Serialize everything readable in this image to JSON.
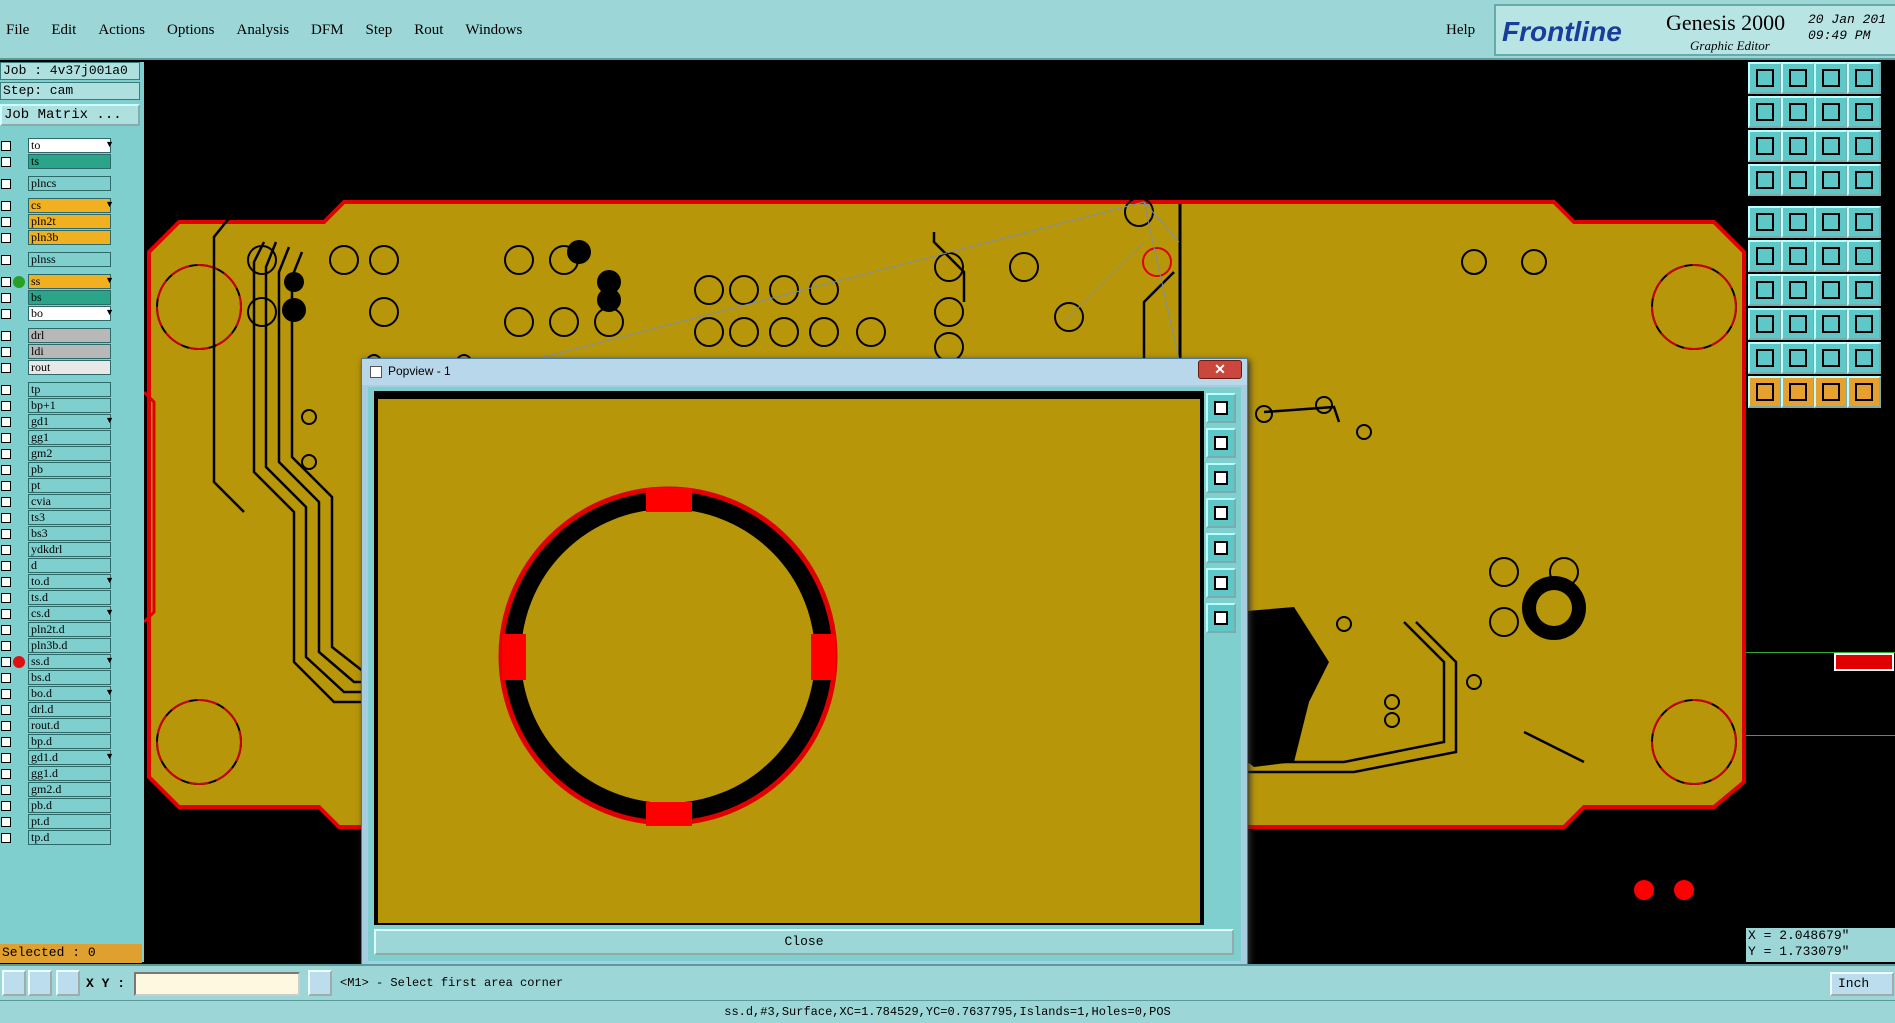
{
  "menu": {
    "items": [
      "File",
      "Edit",
      "Actions",
      "Options",
      "Analysis",
      "DFM",
      "Step",
      "Rout",
      "Windows"
    ],
    "help": "Help"
  },
  "brand": {
    "logo": "Frontline",
    "product": "Genesis 2000",
    "subtitle": "Graphic Editor",
    "date": "20 Jan 201",
    "time": "09:49 PM"
  },
  "left": {
    "job": "Job : 4v37j001a0",
    "step": "Step: cam",
    "matrix_button": "Job Matrix ...",
    "selected": "Selected : 0"
  },
  "layers": [
    {
      "name": "to",
      "bg": "#ffffff",
      "arrow": true
    },
    {
      "name": "ts",
      "bg": "#2aa58a",
      "arrow": false
    },
    {
      "name": "plncs",
      "bg": "#7fcfcf",
      "arrow": false
    },
    {
      "name": "cs",
      "bg": "#f0b020",
      "arrow": true
    },
    {
      "name": "pln2t",
      "bg": "#f0b020",
      "arrow": false
    },
    {
      "name": "pln3b",
      "bg": "#f0b020",
      "arrow": false
    },
    {
      "name": "plnss",
      "bg": "#7fcfcf",
      "arrow": false
    },
    {
      "name": "ss",
      "bg": "#f0b020",
      "arrow": true,
      "dot": "#28a028"
    },
    {
      "name": "bs",
      "bg": "#2aa58a",
      "arrow": false
    },
    {
      "name": "bo",
      "bg": "#ffffff",
      "arrow": true
    },
    {
      "name": "drl",
      "bg": "#b8b8b8",
      "arrow": false
    },
    {
      "name": "ldi",
      "bg": "#b8b8b8",
      "arrow": false
    },
    {
      "name": "rout",
      "bg": "#e8e8e8",
      "arrow": false
    },
    {
      "name": "tp",
      "bg": "#7fcfcf",
      "arrow": false
    },
    {
      "name": "bp+1",
      "bg": "#7fcfcf",
      "arrow": false
    },
    {
      "name": "gd1",
      "bg": "#7fcfcf",
      "arrow": true
    },
    {
      "name": "gg1",
      "bg": "#7fcfcf",
      "arrow": false
    },
    {
      "name": "gm2",
      "bg": "#7fcfcf",
      "arrow": false
    },
    {
      "name": "pb",
      "bg": "#7fcfcf",
      "arrow": false
    },
    {
      "name": "pt",
      "bg": "#7fcfcf",
      "arrow": false
    },
    {
      "name": "cvia",
      "bg": "#7fcfcf",
      "arrow": false
    },
    {
      "name": "ts3",
      "bg": "#7fcfcf",
      "arrow": false
    },
    {
      "name": "bs3",
      "bg": "#7fcfcf",
      "arrow": false
    },
    {
      "name": "ydkdrl",
      "bg": "#7fcfcf",
      "arrow": false
    },
    {
      "name": "d",
      "bg": "#7fcfcf",
      "arrow": false
    },
    {
      "name": "to.d",
      "bg": "#7fcfcf",
      "arrow": true
    },
    {
      "name": "ts.d",
      "bg": "#7fcfcf",
      "arrow": false
    },
    {
      "name": "cs.d",
      "bg": "#7fcfcf",
      "arrow": true
    },
    {
      "name": "pln2t.d",
      "bg": "#7fcfcf",
      "arrow": false
    },
    {
      "name": "pln3b.d",
      "bg": "#7fcfcf",
      "arrow": false
    },
    {
      "name": "ss.d",
      "bg": "#7fcfcf",
      "arrow": true,
      "dot": "#e01010"
    },
    {
      "name": "bs.d",
      "bg": "#7fcfcf",
      "arrow": false
    },
    {
      "name": "bo.d",
      "bg": "#7fcfcf",
      "arrow": true
    },
    {
      "name": "drl.d",
      "bg": "#7fcfcf",
      "arrow": false
    },
    {
      "name": "rout.d",
      "bg": "#7fcfcf",
      "arrow": false
    },
    {
      "name": "bp.d",
      "bg": "#7fcfcf",
      "arrow": false
    },
    {
      "name": "gd1.d",
      "bg": "#7fcfcf",
      "arrow": true
    },
    {
      "name": "gg1.d",
      "bg": "#7fcfcf",
      "arrow": false
    },
    {
      "name": "gm2.d",
      "bg": "#7fcfcf",
      "arrow": false
    },
    {
      "name": "pb.d",
      "bg": "#7fcfcf",
      "arrow": false
    },
    {
      "name": "pt.d",
      "bg": "#7fcfcf",
      "arrow": false
    },
    {
      "name": "tp.d",
      "bg": "#7fcfcf",
      "arrow": false
    }
  ],
  "popup": {
    "title": "Popview - 1",
    "close_label": "Close"
  },
  "cmd": {
    "xy_label": "X Y :",
    "xy_value": "",
    "prompt": "<M1> - Select first area corner",
    "unit": "Inch"
  },
  "coords": {
    "x": "X = 2.048679\"",
    "y": "Y = 1.733079\""
  },
  "status": "ss.d,#3,Surface,XC=1.784529,YC=0.7637795,Islands=1,Holes=0,POS",
  "colors": {
    "board": "#b8960a",
    "profile": "#e00000",
    "panel": "#7fcfcf"
  }
}
